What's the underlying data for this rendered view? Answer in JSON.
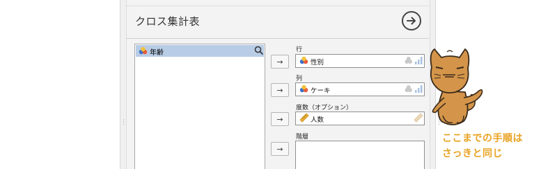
{
  "dialog": {
    "title": "クロス集計表"
  },
  "variables": {
    "items": [
      {
        "label": "年齢",
        "icon": "nominal-variable-icon"
      }
    ]
  },
  "slots": {
    "row": {
      "label": "行",
      "value": "性別"
    },
    "column": {
      "label": "列",
      "value": "ケーキ"
    },
    "frequency": {
      "label": "度数（オプション）",
      "value": "人数"
    },
    "layers": {
      "label": "階層"
    }
  },
  "arrow_glyph": "→",
  "caption": {
    "line1": "ここまでの手順は",
    "line2": "さっきと同じ"
  },
  "colors": {
    "caption": "#e8a221",
    "selected_row": "#b8cce6",
    "cat": "#d4954a"
  }
}
